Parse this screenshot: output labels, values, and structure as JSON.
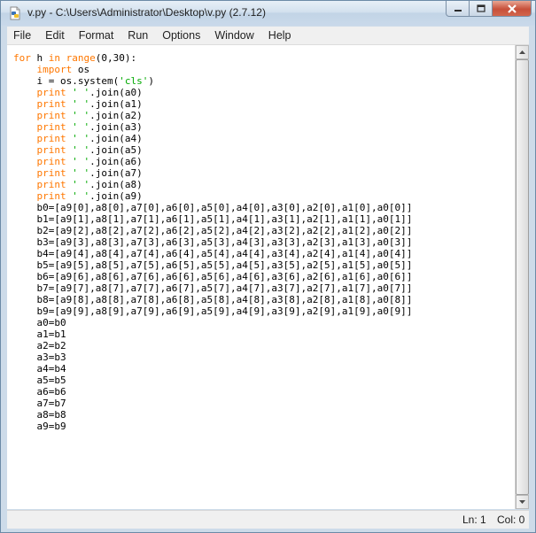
{
  "window": {
    "title": "v.py - C:\\Users\\Administrator\\Desktop\\v.py (2.7.12)",
    "icon": "python-file-icon"
  },
  "menu": [
    "File",
    "Edit",
    "Format",
    "Run",
    "Options",
    "Window",
    "Help"
  ],
  "editor": {
    "lines": [
      [
        {
          "t": "for",
          "c": "kw"
        },
        {
          "t": " h "
        },
        {
          "t": "in",
          "c": "kw"
        },
        {
          "t": " "
        },
        {
          "t": "range",
          "c": "kw"
        },
        {
          "t": "(0,30):"
        }
      ],
      [
        {
          "t": "    "
        },
        {
          "t": "import",
          "c": "kw"
        },
        {
          "t": " os"
        }
      ],
      [
        {
          "t": "    i = os.system("
        },
        {
          "t": "'cls'",
          "c": "str"
        },
        {
          "t": ")"
        }
      ],
      [
        {
          "t": "    "
        },
        {
          "t": "print",
          "c": "kw"
        },
        {
          "t": " "
        },
        {
          "t": "' '",
          "c": "str"
        },
        {
          "t": ".join(a0)"
        }
      ],
      [
        {
          "t": "    "
        },
        {
          "t": "print",
          "c": "kw"
        },
        {
          "t": " "
        },
        {
          "t": "' '",
          "c": "str"
        },
        {
          "t": ".join(a1)"
        }
      ],
      [
        {
          "t": "    "
        },
        {
          "t": "print",
          "c": "kw"
        },
        {
          "t": " "
        },
        {
          "t": "' '",
          "c": "str"
        },
        {
          "t": ".join(a2)"
        }
      ],
      [
        {
          "t": "    "
        },
        {
          "t": "print",
          "c": "kw"
        },
        {
          "t": " "
        },
        {
          "t": "' '",
          "c": "str"
        },
        {
          "t": ".join(a3)"
        }
      ],
      [
        {
          "t": "    "
        },
        {
          "t": "print",
          "c": "kw"
        },
        {
          "t": " "
        },
        {
          "t": "' '",
          "c": "str"
        },
        {
          "t": ".join(a4)"
        }
      ],
      [
        {
          "t": "    "
        },
        {
          "t": "print",
          "c": "kw"
        },
        {
          "t": " "
        },
        {
          "t": "' '",
          "c": "str"
        },
        {
          "t": ".join(a5)"
        }
      ],
      [
        {
          "t": "    "
        },
        {
          "t": "print",
          "c": "kw"
        },
        {
          "t": " "
        },
        {
          "t": "' '",
          "c": "str"
        },
        {
          "t": ".join(a6)"
        }
      ],
      [
        {
          "t": "    "
        },
        {
          "t": "print",
          "c": "kw"
        },
        {
          "t": " "
        },
        {
          "t": "' '",
          "c": "str"
        },
        {
          "t": ".join(a7)"
        }
      ],
      [
        {
          "t": "    "
        },
        {
          "t": "print",
          "c": "kw"
        },
        {
          "t": " "
        },
        {
          "t": "' '",
          "c": "str"
        },
        {
          "t": ".join(a8)"
        }
      ],
      [
        {
          "t": "    "
        },
        {
          "t": "print",
          "c": "kw"
        },
        {
          "t": " "
        },
        {
          "t": "' '",
          "c": "str"
        },
        {
          "t": ".join(a9)"
        }
      ],
      [
        {
          "t": "    b0=[a9[0],a8[0],a7[0],a6[0],a5[0],a4[0],a3[0],a2[0],a1[0],a0[0]]"
        }
      ],
      [
        {
          "t": "    b1=[a9[1],a8[1],a7[1],a6[1],a5[1],a4[1],a3[1],a2[1],a1[1],a0[1]]"
        }
      ],
      [
        {
          "t": "    b2=[a9[2],a8[2],a7[2],a6[2],a5[2],a4[2],a3[2],a2[2],a1[2],a0[2]]"
        }
      ],
      [
        {
          "t": "    b3=[a9[3],a8[3],a7[3],a6[3],a5[3],a4[3],a3[3],a2[3],a1[3],a0[3]]"
        }
      ],
      [
        {
          "t": "    b4=[a9[4],a8[4],a7[4],a6[4],a5[4],a4[4],a3[4],a2[4],a1[4],a0[4]]"
        }
      ],
      [
        {
          "t": "    b5=[a9[5],a8[5],a7[5],a6[5],a5[5],a4[5],a3[5],a2[5],a1[5],a0[5]]"
        }
      ],
      [
        {
          "t": "    b6=[a9[6],a8[6],a7[6],a6[6],a5[6],a4[6],a3[6],a2[6],a1[6],a0[6]]"
        }
      ],
      [
        {
          "t": "    b7=[a9[7],a8[7],a7[7],a6[7],a5[7],a4[7],a3[7],a2[7],a1[7],a0[7]]"
        }
      ],
      [
        {
          "t": "    b8=[a9[8],a8[8],a7[8],a6[8],a5[8],a4[8],a3[8],a2[8],a1[8],a0[8]]"
        }
      ],
      [
        {
          "t": "    b9=[a9[9],a8[9],a7[9],a6[9],a5[9],a4[9],a3[9],a2[9],a1[9],a0[9]]"
        }
      ],
      [
        {
          "t": "    a0=b0"
        }
      ],
      [
        {
          "t": "    a1=b1"
        }
      ],
      [
        {
          "t": "    a2=b2"
        }
      ],
      [
        {
          "t": "    a3=b3"
        }
      ],
      [
        {
          "t": "    a4=b4"
        }
      ],
      [
        {
          "t": "    a5=b5"
        }
      ],
      [
        {
          "t": "    a6=b6"
        }
      ],
      [
        {
          "t": "    a7=b7"
        }
      ],
      [
        {
          "t": "    a8=b8"
        }
      ],
      [
        {
          "t": "    a9=b9"
        }
      ]
    ]
  },
  "status": {
    "line": "Ln: 1",
    "col": "Col: 0"
  },
  "colors": {
    "keyword": "#ff7700",
    "string": "#00aa00",
    "text": "#000000"
  }
}
